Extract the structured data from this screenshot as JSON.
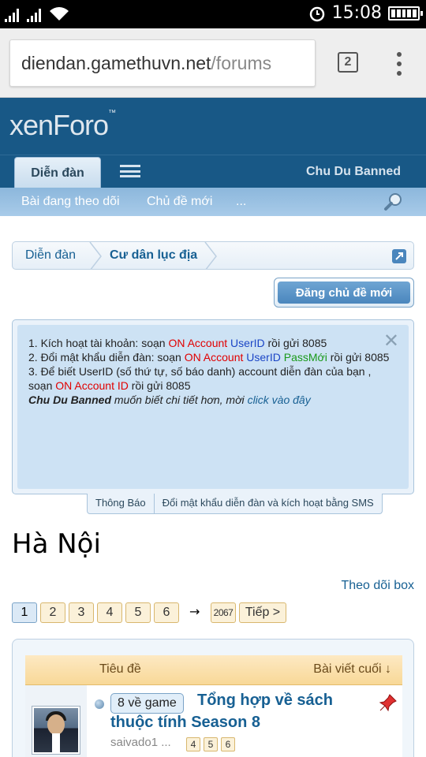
{
  "status_bar": {
    "time": "15:08"
  },
  "browser": {
    "url_main": "diendan.gamethuvn.net",
    "url_path": "/forums",
    "tab_count": "2"
  },
  "site": {
    "logo": "xenForo",
    "nav": {
      "active_tab": "Diễn đàn",
      "user": "Chu Du Banned"
    },
    "subnav": [
      "Bài đang theo dõi",
      "Chủ đề mới",
      "..."
    ]
  },
  "breadcrumb": [
    "Diễn đàn",
    "Cư dân lục địa"
  ],
  "new_thread_button": "Đăng chủ đề mới",
  "notice": {
    "line1_prefix": "1. Kích hoạt tài khoản: soạn ",
    "line1_red": "ON Account",
    "line1_blue": " UserID",
    "line1_suffix": " rồi gửi 8085",
    "line2_prefix": "2. Đổi mật khẩu diễn đàn: soạn ",
    "line2_red": "ON Account",
    "line2_blue": " UserID",
    "line2_green": " PassMới",
    "line2_suffix": " rồi gửi 8085",
    "line3_prefix": "3. Để biết UserID (số thứ tự, số báo danh) account diễn đàn của bạn , soạn ",
    "line3_red": "ON Account ID",
    "line3_suffix": " rồi gửi 8085",
    "line4_user": "Chu Du Banned",
    "line4_text": " muốn biết chi tiết hơn, mời ",
    "line4_link": "click vào đây",
    "tabs": [
      "Thông Báo",
      "Đổi mật khẩu diễn đàn và kích hoạt bằng SMS"
    ]
  },
  "forum": {
    "title": "Hà Nội",
    "watch_link": "Theo dõi box"
  },
  "pagination": {
    "pages": [
      "1",
      "2",
      "3",
      "4",
      "5",
      "6"
    ],
    "arrow": "→",
    "last": "2067",
    "next": "Tiếp >"
  },
  "thread_list": {
    "col_title": "Tiêu đề",
    "col_last": "Bài viết cuối ↓",
    "threads": [
      {
        "prefix": "8 về game",
        "title_line1": "Tổng hợp về sách",
        "title_line2": "thuộc tính Season 8",
        "author": "saivado1",
        "ellipsis": "...",
        "pages": [
          "4",
          "5",
          "6"
        ]
      }
    ]
  }
}
